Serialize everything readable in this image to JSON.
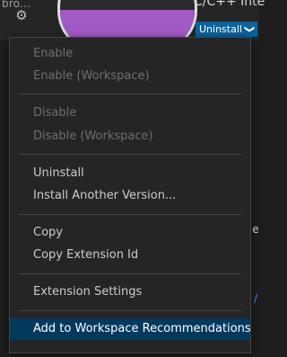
{
  "background": {
    "left_text": "bro...",
    "extension_title": "C/C++ Inte",
    "uninstall_button": "Uninstall",
    "dropdown_glyph": "❯"
  },
  "menu": {
    "items": [
      {
        "label": "Enable",
        "enabled": false
      },
      {
        "label": "Enable (Workspace)",
        "enabled": false
      },
      {
        "label": "Disable",
        "enabled": false
      },
      {
        "label": "Disable (Workspace)",
        "enabled": false
      },
      {
        "label": "Uninstall",
        "enabled": true
      },
      {
        "label": "Install Another Version...",
        "enabled": true
      },
      {
        "label": "Copy",
        "enabled": true
      },
      {
        "label": "Copy Extension Id",
        "enabled": true
      },
      {
        "label": "Extension Settings",
        "enabled": true
      },
      {
        "label": "Add to Workspace Recommendations",
        "enabled": true,
        "selected": true
      }
    ]
  },
  "colors": {
    "menu_background": "#252526",
    "selection": "#04395e",
    "button": "#0e639c"
  }
}
